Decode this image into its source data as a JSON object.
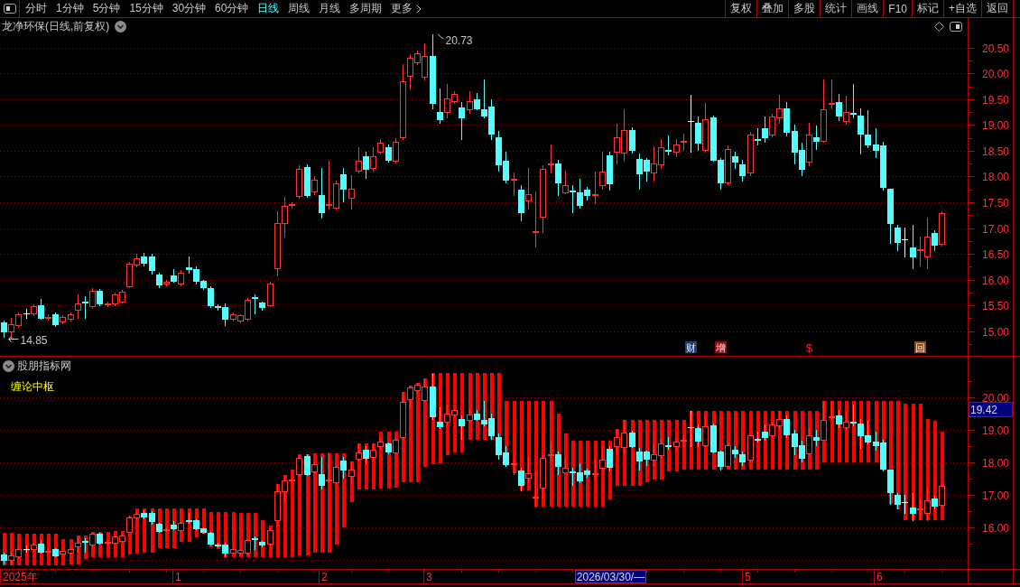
{
  "toolbar": {
    "periods": [
      {
        "label": "分时",
        "selected": false,
        "kind": "period"
      },
      {
        "label": "1分钟",
        "selected": false,
        "kind": "period"
      },
      {
        "label": "5分钟",
        "selected": false,
        "kind": "period"
      },
      {
        "label": "15分钟",
        "selected": false,
        "kind": "period"
      },
      {
        "label": "30分钟",
        "selected": false,
        "kind": "period"
      },
      {
        "label": "60分钟",
        "selected": false,
        "kind": "period"
      },
      {
        "label": "日线",
        "selected": true,
        "kind": "period"
      },
      {
        "label": "周线",
        "selected": false,
        "kind": "period"
      },
      {
        "label": "月线",
        "selected": false,
        "kind": "period"
      },
      {
        "label": "多周期",
        "selected": false,
        "kind": "period"
      },
      {
        "label": "更多",
        "selected": false,
        "kind": "menu"
      }
    ],
    "buttons": [
      "复权",
      "叠加",
      "多股",
      "统计",
      "画线",
      "F10",
      "标记",
      "+自选",
      "返回"
    ]
  },
  "price_panel": {
    "title": "龙净环保(日线,前复权)",
    "high_label": "20.73",
    "low_label": "14.85",
    "markers": [
      {
        "label": "财",
        "kind": "boxed",
        "color": "#1b3f7c"
      },
      {
        "label": "增",
        "kind": "boxed",
        "color": "#8c0c0c"
      },
      {
        "label": "$",
        "kind": "plain",
        "color": "#ff2020"
      },
      {
        "label": "回",
        "kind": "boxed",
        "color": "#8a4a14"
      }
    ],
    "price_axis": [
      "20.50",
      "20.00",
      "19.50",
      "19.00",
      "18.50",
      "18.00",
      "17.50",
      "17.00",
      "16.50",
      "16.00",
      "15.50",
      "15.00"
    ]
  },
  "indicator_panel": {
    "source": "股朋指标网",
    "indicator": "缠论中枢",
    "price_axis": [
      "20.00",
      "19.00",
      "18.00",
      "17.00",
      "16.00"
    ],
    "cursor_price": "19.42"
  },
  "time_axis": {
    "labels": [
      "2025年",
      "1",
      "2",
      "3",
      "5",
      "6"
    ],
    "cursor_date": "2026/03/30/—"
  }
}
